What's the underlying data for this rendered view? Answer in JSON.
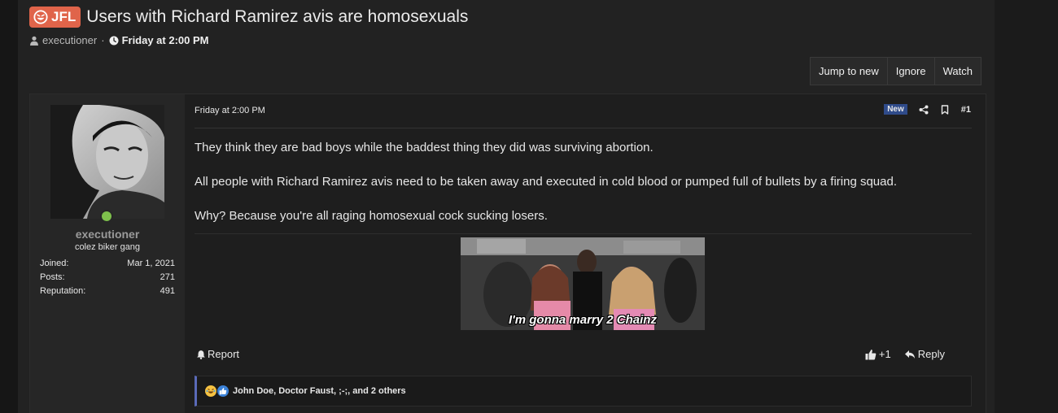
{
  "thread": {
    "prefix": "JFL",
    "title": "Users with Richard Ramirez avis are homosexuals",
    "author": "executioner",
    "separator": "·",
    "date": "Friday at 2:00 PM"
  },
  "thread_buttons": [
    "Jump to new",
    "Ignore",
    "Watch"
  ],
  "post": {
    "user": {
      "name": "executioner",
      "title": "colez biker gang",
      "stats": [
        {
          "label": "Joined:",
          "value": "Mar 1, 2021"
        },
        {
          "label": "Posts:",
          "value": "271"
        },
        {
          "label": "Reputation:",
          "value": "491"
        }
      ]
    },
    "date": "Friday at 2:00 PM",
    "badge": "New",
    "number": "#1",
    "paragraphs": [
      "They think they are bad boys while the baddest thing they did was surviving abortion.",
      "All people with Richard Ramirez avis need to be taken away and executed in cold blood or pumped full of bullets by a firing squad.",
      "Why? Because you're all raging homosexual cock sucking losers."
    ],
    "gif_caption": "I'm gonna marry 2 Chainz",
    "report_label": "Report",
    "like_label": "+1",
    "reply_label": "Reply",
    "reactions_text": "John Doe, Doctor Faust, ;-;, and 2 others"
  },
  "colors": {
    "prefix_bg": "#e0644a",
    "online": "#7ec04c",
    "new_badge": "#2f4b8a",
    "reaction_bar": "#5a6ab8"
  }
}
